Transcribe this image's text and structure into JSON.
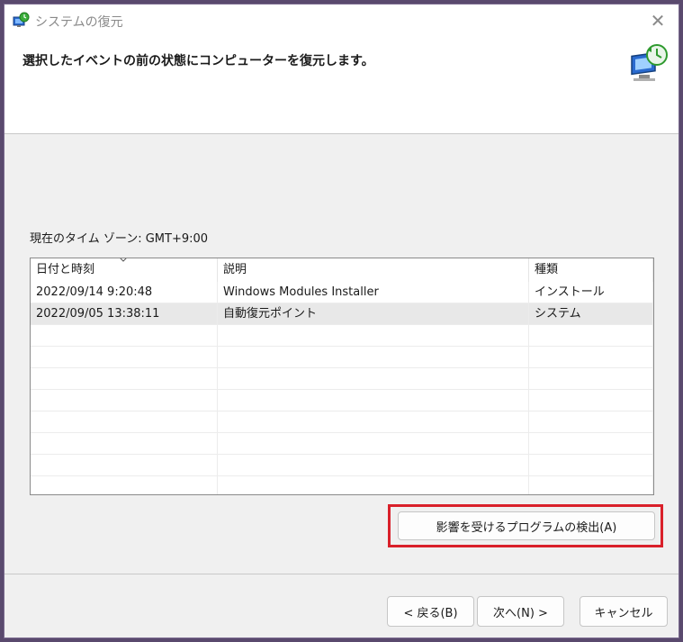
{
  "window": {
    "title": "システムの復元",
    "header": "選択したイベントの前の状態にコンピューターを復元します。"
  },
  "timezone": "現在のタイム ゾーン: GMT+9:00",
  "table": {
    "columns": [
      "日付と時刻",
      "説明",
      "種類"
    ],
    "rows": [
      [
        "2022/09/14 9:20:48",
        "Windows Modules Installer",
        "インストール"
      ],
      [
        "2022/09/05 13:38:11",
        "自動復元ポイント",
        "システム"
      ]
    ],
    "selected_row": 1
  },
  "buttons": {
    "scan": "影響を受けるプログラムの検出(A)",
    "back": "< 戻る(B)",
    "next": "次へ(N) >",
    "cancel": "キャンセル"
  },
  "colors": {
    "highlight": "#d9202a",
    "selected_row": "#e8e8e8"
  },
  "icons": {
    "title": "system-restore-icon",
    "header": "computer-restore-icon",
    "close": "close-icon",
    "sort": "sort-arrow-icon"
  }
}
